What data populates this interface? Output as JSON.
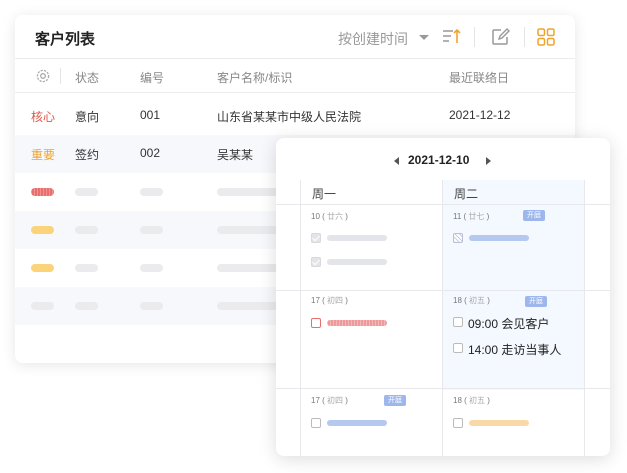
{
  "list": {
    "title": "客户列表",
    "sort_label": "按创建时间",
    "columns": [
      "状态",
      "编号",
      "客户名称/标识",
      "最近联络日"
    ],
    "rows": [
      {
        "tag": "核心",
        "status": "意向",
        "id": "001",
        "name": "山东省某某市中级人民法院",
        "date": "2021-12-12"
      },
      {
        "tag": "重要",
        "status": "签约",
        "id": "002",
        "name": "吴某某",
        "date": ""
      }
    ]
  },
  "calendar": {
    "current_date": "2021-12-10",
    "weekdays": [
      "周一",
      "周二"
    ],
    "cells": [
      {
        "day": "10",
        "lunar": "廿六"
      },
      {
        "day": "11",
        "lunar": "廿七",
        "badge": "开庭"
      },
      {
        "day": "17",
        "lunar": "初四"
      },
      {
        "day": "18",
        "lunar": "初五",
        "badge": "开庭"
      },
      {
        "day": "17",
        "lunar": "初四",
        "badge": "开庭"
      },
      {
        "day": "18",
        "lunar": "初五"
      }
    ],
    "events": [
      "09:00 会见客户",
      "14:00 走访当事人"
    ]
  },
  "colors": {
    "core_tag": "#e2574c",
    "important_tag": "#f0a32b",
    "holiday_badge": "#9db7ec",
    "accent": "#f0a32b"
  }
}
